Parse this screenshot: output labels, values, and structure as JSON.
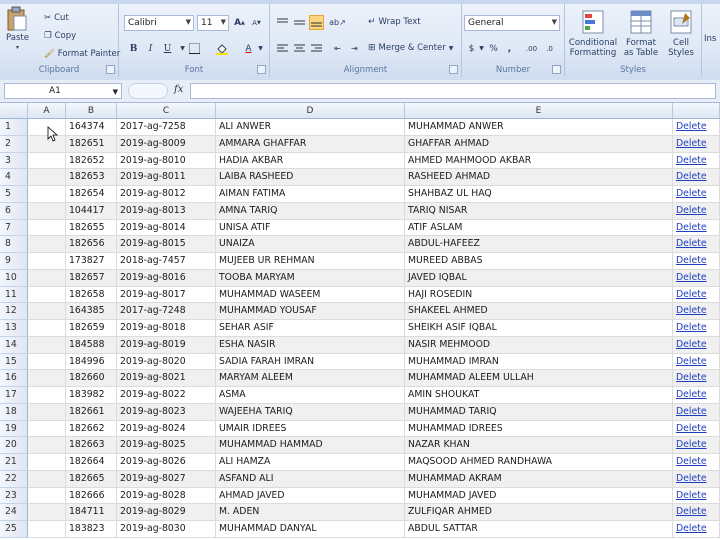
{
  "ribbon": {
    "clipboard": {
      "paste_label": "Paste",
      "cut_label": "Cut",
      "copy_label": "Copy",
      "format_painter_label": "Format Painter",
      "group_label": "Clipboard"
    },
    "font": {
      "font_name": "Calibri",
      "font_size": "11",
      "grow_label": "A",
      "shrink_label": "A",
      "bold_label": "B",
      "italic_label": "I",
      "underline_label": "U",
      "font_color_label": "A",
      "group_label": "Font"
    },
    "alignment": {
      "wrap_text_label": "Wrap Text",
      "merge_center_label": "Merge & Center",
      "group_label": "Alignment"
    },
    "number": {
      "format_value": "General",
      "currency_label": "$",
      "percent_label": "%",
      "comma_label": ",",
      "increase_decimal_label": ".00",
      "decrease_decimal_label": ".0",
      "group_label": "Number"
    },
    "styles": {
      "conditional_formatting_label1": "Conditional",
      "conditional_formatting_label2": "Formatting",
      "format_table_label1": "Format",
      "format_table_label2": "as Table",
      "cell_styles_label1": "Cell",
      "cell_styles_label2": "Styles",
      "group_label": "Styles"
    },
    "cells": {
      "insert_label": "Ins"
    }
  },
  "formula_bar": {
    "name_box": "A1",
    "fx_label": "fx"
  },
  "columns": [
    "A",
    "B",
    "C",
    "D",
    "E"
  ],
  "rows": [
    {
      "n": "1",
      "b": "164374",
      "c": "2017-ag-7258",
      "d": "ALI ANWER",
      "e": "MUHAMMAD ANWER",
      "f": "Delete"
    },
    {
      "n": "2",
      "b": "182651",
      "c": "2019-ag-8009",
      "d": "AMMARA GHAFFAR",
      "e": "GHAFFAR AHMAD",
      "f": "Delete"
    },
    {
      "n": "3",
      "b": "182652",
      "c": "2019-ag-8010",
      "d": "HADIA AKBAR",
      "e": "AHMED MAHMOOD AKBAR",
      "f": "Delete"
    },
    {
      "n": "4",
      "b": "182653",
      "c": "2019-ag-8011",
      "d": "LAIBA RASHEED",
      "e": "RASHEED AHMAD",
      "f": "Delete"
    },
    {
      "n": "5",
      "b": "182654",
      "c": "2019-ag-8012",
      "d": "AIMAN FATIMA",
      "e": "SHAHBAZ UL HAQ",
      "f": "Delete"
    },
    {
      "n": "6",
      "b": "104417",
      "c": "2019-ag-8013",
      "d": "AMNA TARIQ",
      "e": "TARIQ NISAR",
      "f": "Delete"
    },
    {
      "n": "7",
      "b": "182655",
      "c": "2019-ag-8014",
      "d": "UNISA ATIF",
      "e": "ATIF ASLAM",
      "f": "Delete"
    },
    {
      "n": "8",
      "b": "182656",
      "c": "2019-ag-8015",
      "d": "UNAIZA",
      "e": "ABDUL-HAFEEZ",
      "f": "Delete"
    },
    {
      "n": "9",
      "b": "173827",
      "c": "2018-ag-7457",
      "d": "MUJEEB UR REHMAN",
      "e": "MUREED ABBAS",
      "f": "Delete"
    },
    {
      "n": "10",
      "b": "182657",
      "c": "2019-ag-8016",
      "d": "TOOBA MARYAM",
      "e": "JAVED IQBAL",
      "f": "Delete"
    },
    {
      "n": "11",
      "b": "182658",
      "c": "2019-ag-8017",
      "d": "MUHAMMAD WASEEM",
      "e": "HAJI ROSEDIN",
      "f": "Delete"
    },
    {
      "n": "12",
      "b": "164385",
      "c": "2017-ag-7248",
      "d": "MUHAMMAD YOUSAF",
      "e": "SHAKEEL AHMED",
      "f": "Delete"
    },
    {
      "n": "13",
      "b": "182659",
      "c": "2019-ag-8018",
      "d": "SEHAR ASIF",
      "e": "SHEIKH ASIF IQBAL",
      "f": "Delete"
    },
    {
      "n": "14",
      "b": "184588",
      "c": "2019-ag-8019",
      "d": "ESHA NASIR",
      "e": "NASIR MEHMOOD",
      "f": "Delete"
    },
    {
      "n": "15",
      "b": "184996",
      "c": "2019-ag-8020",
      "d": "SADIA FARAH IMRAN",
      "e": "MUHAMMAD IMRAN",
      "f": "Delete"
    },
    {
      "n": "16",
      "b": "182660",
      "c": "2019-ag-8021",
      "d": "MARYAM ALEEM",
      "e": "MUHAMMAD ALEEM ULLAH",
      "f": "Delete"
    },
    {
      "n": "17",
      "b": "183982",
      "c": "2019-ag-8022",
      "d": "ASMA",
      "e": "AMIN SHOUKAT",
      "f": "Delete"
    },
    {
      "n": "18",
      "b": "182661",
      "c": "2019-ag-8023",
      "d": "WAJEEHA TARIQ",
      "e": "MUHAMMAD TARIQ",
      "f": "Delete"
    },
    {
      "n": "19",
      "b": "182662",
      "c": "2019-ag-8024",
      "d": "UMAIR IDREES",
      "e": "MUHAMMAD IDREES",
      "f": "Delete"
    },
    {
      "n": "20",
      "b": "182663",
      "c": "2019-ag-8025",
      "d": "MUHAMMAD HAMMAD",
      "e": "NAZAR KHAN",
      "f": "Delete"
    },
    {
      "n": "21",
      "b": "182664",
      "c": "2019-ag-8026",
      "d": "ALI HAMZA",
      "e": "MAQSOOD AHMED RANDHAWA",
      "f": "Delete"
    },
    {
      "n": "22",
      "b": "182665",
      "c": "2019-ag-8027",
      "d": "ASFAND ALI",
      "e": "MUHAMMAD AKRAM",
      "f": "Delete"
    },
    {
      "n": "23",
      "b": "182666",
      "c": "2019-ag-8028",
      "d": "AHMAD JAVED",
      "e": "MUHAMMAD JAVED",
      "f": "Delete"
    },
    {
      "n": "24",
      "b": "184711",
      "c": "2019-ag-8029",
      "d": "M. ADEN",
      "e": "ZULFIQAR AHMED",
      "f": "Delete"
    },
    {
      "n": "25",
      "b": "183823",
      "c": "2019-ag-8030",
      "d": "MUHAMMAD DANYAL",
      "e": "ABDUL SATTAR",
      "f": "Delete"
    }
  ]
}
